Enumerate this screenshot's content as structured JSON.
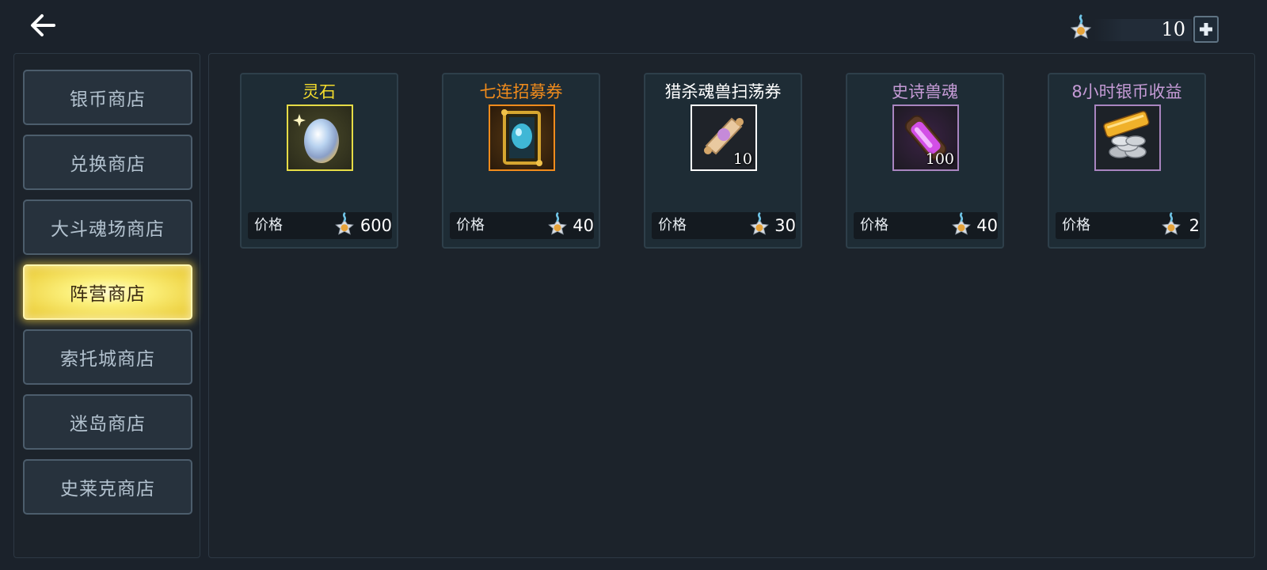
{
  "header": {
    "back_icon": "arrow-left-icon",
    "currency": {
      "icon": "star-badge-icon",
      "amount": "10",
      "add_icon": "plus-icon"
    }
  },
  "sidebar": {
    "tabs": [
      {
        "label": "银币商店",
        "active": false
      },
      {
        "label": "兑换商店",
        "active": false
      },
      {
        "label": "大斗魂场商店",
        "active": false
      },
      {
        "label": "阵营商店",
        "active": true
      },
      {
        "label": "索托城商店",
        "active": false
      },
      {
        "label": "迷岛商店",
        "active": false
      },
      {
        "label": "史莱克商店",
        "active": false
      }
    ]
  },
  "shop": {
    "items": [
      {
        "name": "灵石",
        "name_color": "#f4dc2c",
        "frame_color": "#e6dc46",
        "icon": "spirit-stone-egg-icon",
        "quantity": "",
        "price_label": "价格",
        "price": "600"
      },
      {
        "name": "七连招募券",
        "name_color": "#f08b1c",
        "frame_color": "#f08b1c",
        "icon": "recruit-card-icon",
        "quantity": "",
        "price_label": "价格",
        "price": "40"
      },
      {
        "name": "猎杀魂兽扫荡券",
        "name_color": "#ffffff",
        "frame_color": "#ffffff",
        "icon": "scroll-icon",
        "quantity": "10",
        "price_label": "价格",
        "price": "30"
      },
      {
        "name": "史诗兽魂",
        "name_color": "#c59bd6",
        "frame_color": "#a985c0",
        "icon": "soul-vial-icon",
        "quantity": "100",
        "price_label": "价格",
        "price": "40"
      },
      {
        "name": "8小时银币收益",
        "name_color": "#c59bd6",
        "frame_color": "#a985c0",
        "icon": "silver-coins-icon",
        "quantity": "",
        "price_label": "价格",
        "price": "2"
      }
    ]
  }
}
